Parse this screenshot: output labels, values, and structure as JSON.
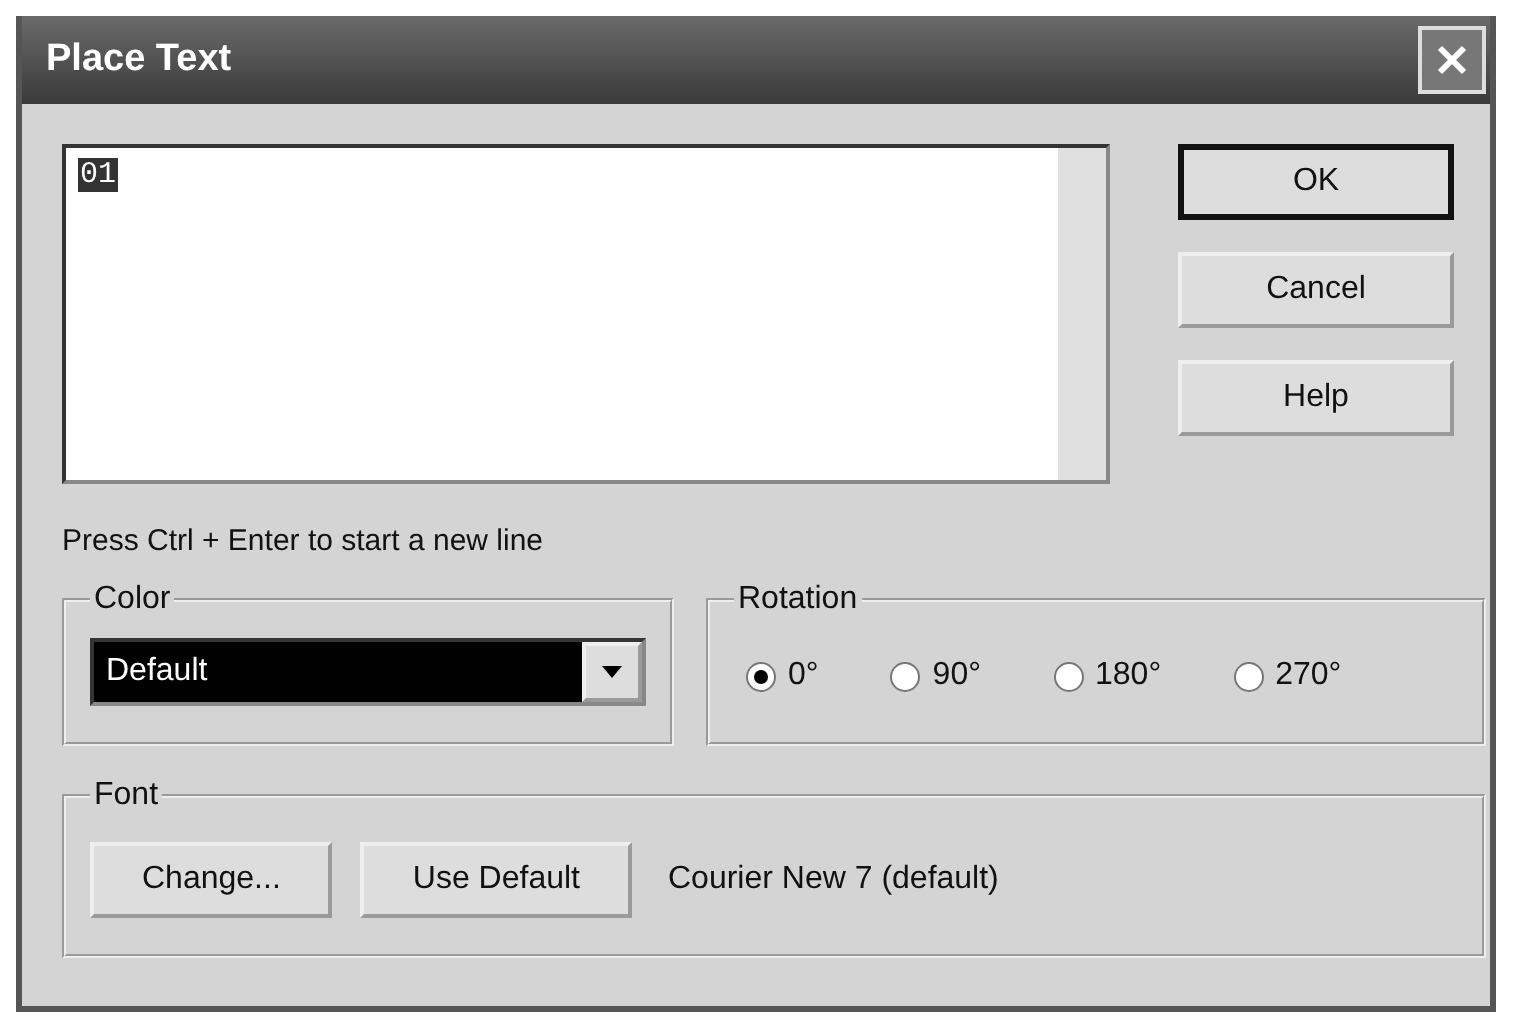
{
  "window": {
    "title": "Place Text"
  },
  "text_field": {
    "value": "01",
    "selected": true
  },
  "buttons": [
    {
      "label": "OK",
      "default": true
    },
    {
      "label": "Cancel",
      "default": false
    },
    {
      "label": "Help",
      "default": false
    }
  ],
  "hint": "Press Ctrl + Enter to start a new line",
  "color_group": {
    "title": "Color",
    "value": "Default"
  },
  "rotation_group": {
    "title": "Rotation",
    "options": [
      {
        "label": "0°",
        "selected": true
      },
      {
        "label": "90°",
        "selected": false
      },
      {
        "label": "180°",
        "selected": false
      },
      {
        "label": "270°",
        "selected": false
      }
    ]
  },
  "font_group": {
    "title": "Font",
    "buttons": [
      "Change...",
      "Use Default"
    ],
    "current": "Courier New 7 (default)"
  }
}
